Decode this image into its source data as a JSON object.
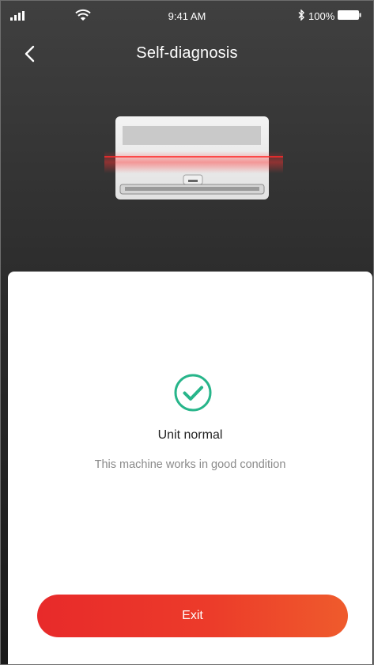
{
  "status_bar": {
    "time": "9:41 AM",
    "battery": "100%",
    "icons": [
      "signal-icon",
      "wifi-icon",
      "bluetooth-icon",
      "battery-icon"
    ]
  },
  "nav": {
    "title": "Self-diagnosis",
    "back_icon": "chevron-left-icon"
  },
  "result": {
    "icon": "check-circle-icon",
    "title": "Unit normal",
    "description": "This machine works in good condition"
  },
  "actions": {
    "exit_label": "Exit"
  },
  "colors": {
    "accent_start": "#e82a2a",
    "accent_end": "#ef5b2c",
    "success": "#27b58a",
    "header_background": "#2b2b2b"
  }
}
